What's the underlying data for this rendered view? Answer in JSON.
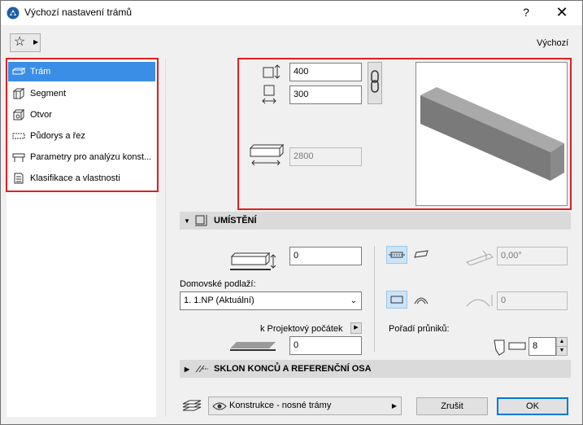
{
  "window": {
    "title": "Výchozí nastavení trámů",
    "help": "?",
    "close": "✕"
  },
  "toolbar": {
    "default_label": "Výchozí"
  },
  "nav": {
    "items": [
      {
        "label": "Trám",
        "icon": "beam-icon",
        "selected": true
      },
      {
        "label": "Segment",
        "icon": "segment-icon"
      },
      {
        "label": "Otvor",
        "icon": "opening-icon"
      },
      {
        "label": "Půdorys a řez",
        "icon": "floorplan-section-icon"
      },
      {
        "label": "Parametry pro analýzu konst...",
        "icon": "structural-analysis-icon"
      },
      {
        "label": "Klasifikace a vlastnosti",
        "icon": "classification-icon"
      }
    ]
  },
  "geometry": {
    "height": "400",
    "width": "300",
    "length": "2800"
  },
  "placement": {
    "title": "UMÍSTĚNÍ",
    "offset": "0",
    "home_story_label": "Domovské podlaží:",
    "home_story_value": "1. 1.NP (Aktuální)",
    "ref_label": "k Projektový počátek",
    "ref_value": "0",
    "angle_value": "0,00°",
    "slant_value": "0",
    "intersection_label": "Pořadí průniků:",
    "intersection_value": "8"
  },
  "section2": {
    "title": "SKLON KONCŮ A REFERENČNÍ OSA"
  },
  "footer": {
    "layer_value": "Konstrukce - nosné trámy",
    "cancel": "Zrušit",
    "ok": "OK"
  },
  "colors": {
    "selection": "#3a8ee6",
    "highlight_border": "#e02020",
    "ok_border": "#0078d7"
  }
}
